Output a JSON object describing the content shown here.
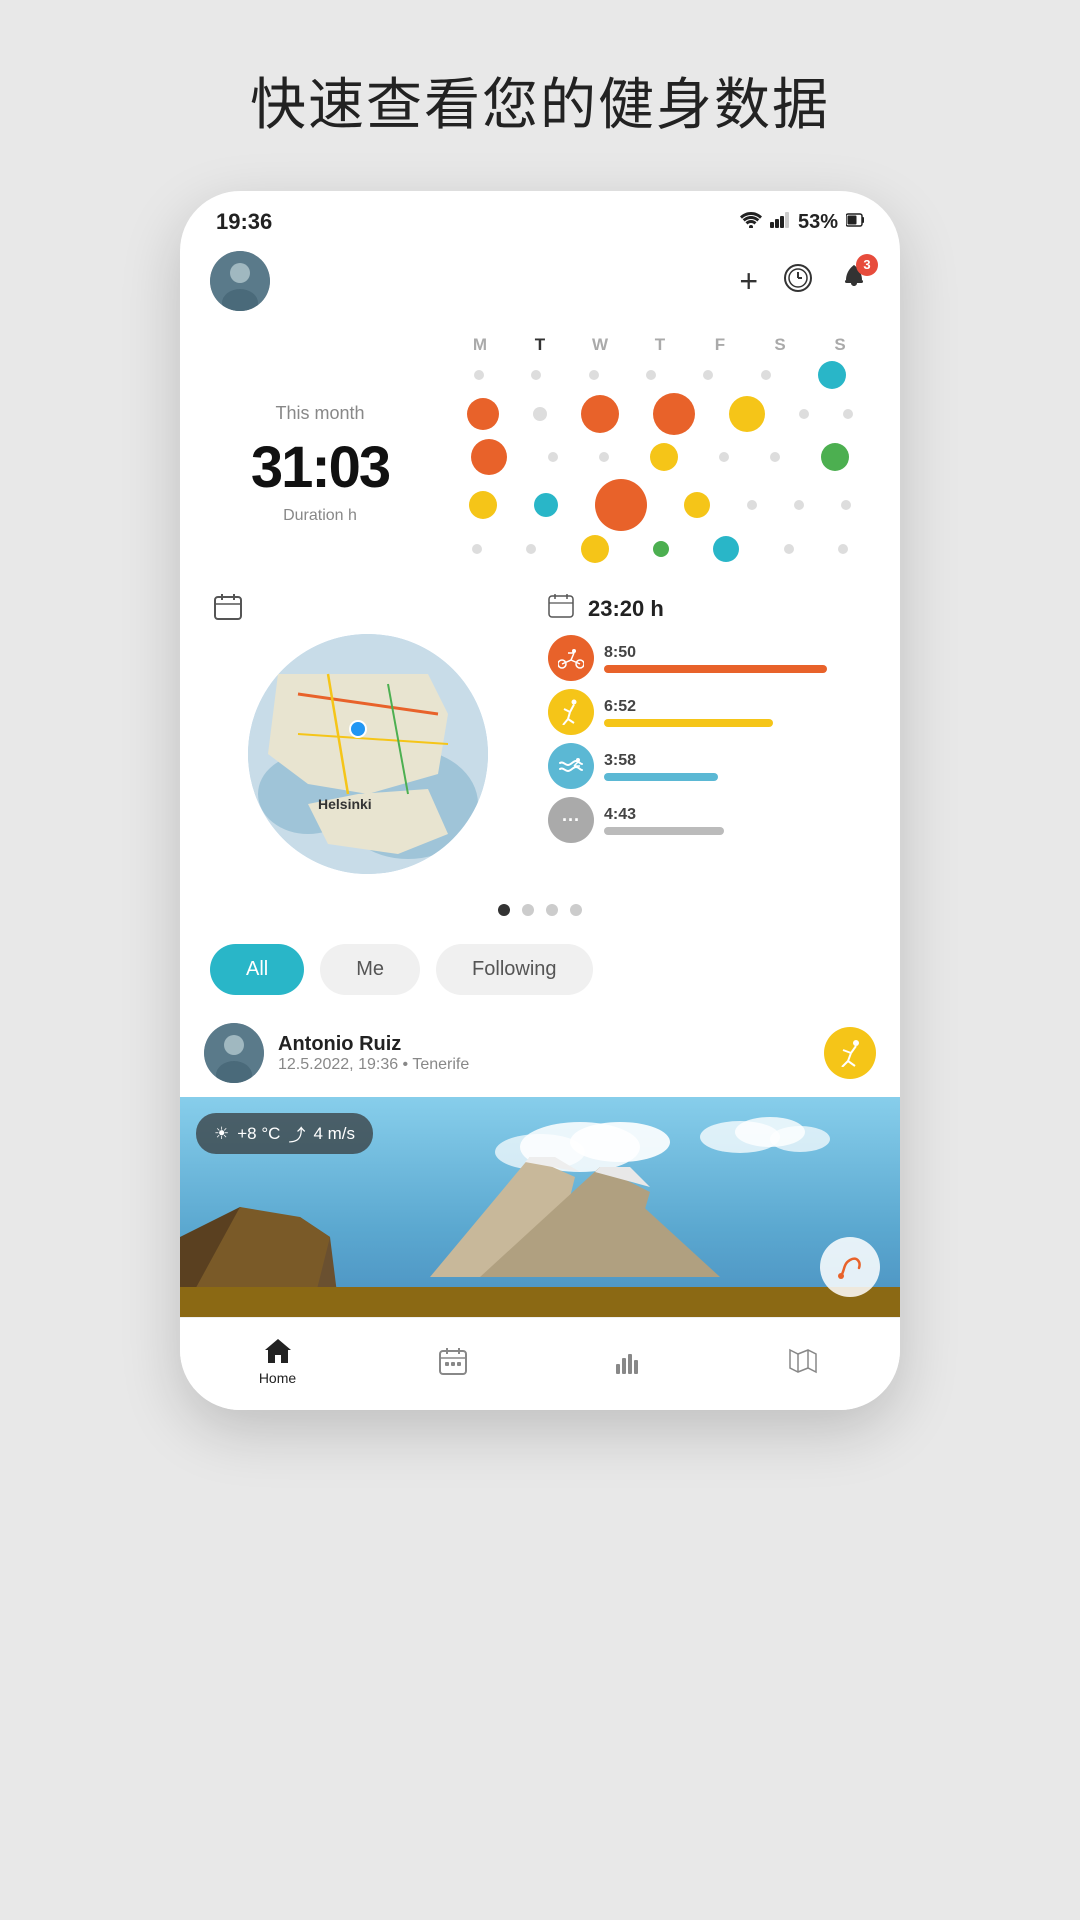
{
  "page": {
    "title": "快速查看您的健身数据",
    "bg_color": "#e8e8e8"
  },
  "status_bar": {
    "time": "19:36",
    "battery": "53%"
  },
  "header": {
    "add_label": "+",
    "notification_badge": "3"
  },
  "stats": {
    "period_label": "This month",
    "duration_value": "31:03",
    "duration_unit": "Duration h",
    "weekdays": [
      "M",
      "T",
      "W",
      "T",
      "F",
      "S",
      "S"
    ],
    "today_index": 1
  },
  "activity_card": {
    "calendar_icon": "📅",
    "total_label": "23:20 h",
    "activities": [
      {
        "type": "cycling",
        "time": "8:50",
        "color": "#e8622a",
        "bar_width": "82%",
        "icon": "🚴",
        "bg": "#e8622a"
      },
      {
        "type": "running",
        "time": "6:52",
        "color": "#f5c518",
        "bar_width": "62%",
        "icon": "🏃",
        "bg": "#f5c518"
      },
      {
        "type": "swimming",
        "time": "3:58",
        "color": "#5bb8d4",
        "bar_width": "42%",
        "icon": "🏊",
        "bg": "#5bb8d4"
      },
      {
        "type": "other",
        "time": "4:43",
        "color": "#aaa",
        "bar_width": "44%",
        "icon": "···",
        "bg": "#aaa"
      }
    ]
  },
  "map": {
    "city": "Helsinki",
    "calendar_icon": "📅"
  },
  "pagination": {
    "total": 4,
    "active": 0
  },
  "filter_tabs": [
    {
      "label": "All",
      "active": true
    },
    {
      "label": "Me",
      "active": false
    },
    {
      "label": "Following",
      "active": false
    }
  ],
  "feed": {
    "user_name": "Antonio Ruiz",
    "user_meta": "12.5.2022, 19:36 • Tenerife",
    "sport": "running"
  },
  "weather": {
    "temp": "+8 °C",
    "wind": "4 m/s"
  },
  "bottom_nav": [
    {
      "label": "Home",
      "icon": "home",
      "active": true
    },
    {
      "label": "",
      "icon": "calendar",
      "active": false
    },
    {
      "label": "",
      "icon": "chart",
      "active": false
    },
    {
      "label": "",
      "icon": "map",
      "active": false
    }
  ]
}
